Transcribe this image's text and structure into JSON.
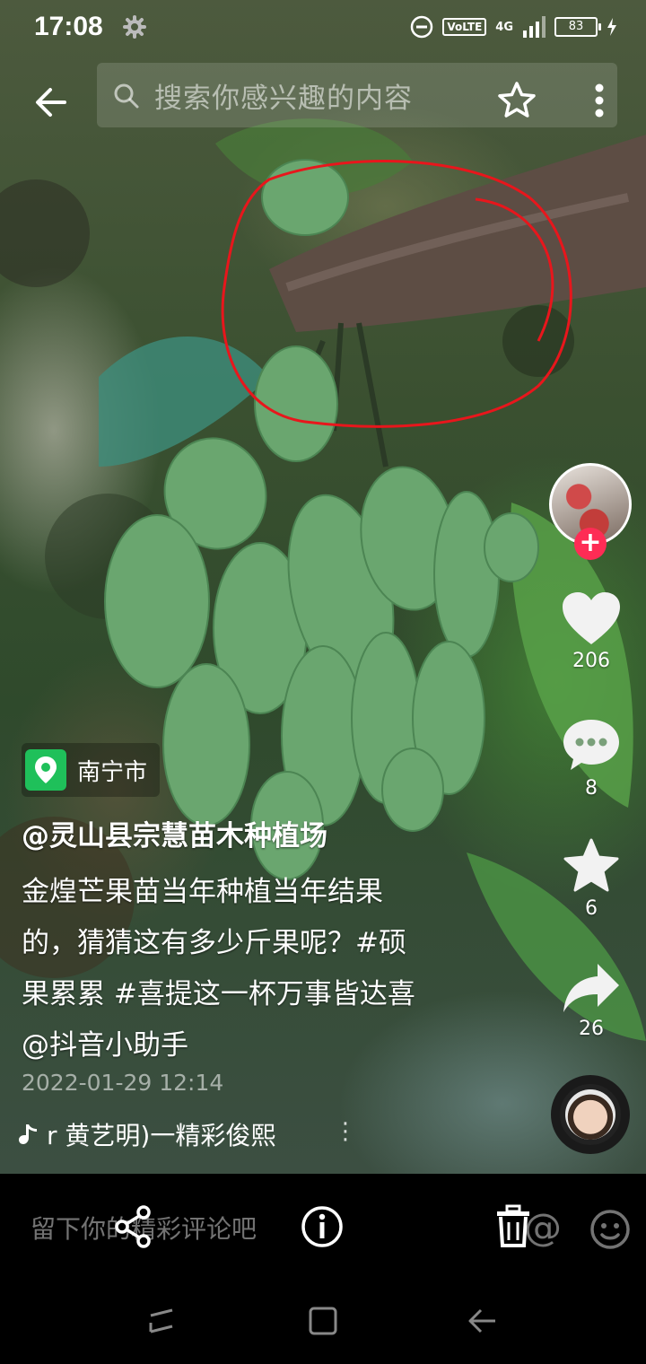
{
  "status_bar": {
    "time": "17:08",
    "network_badge": "VoLTE",
    "network_type": "4G",
    "battery": "83"
  },
  "top_bar": {
    "search_placeholder": "搜索你感兴趣的内容"
  },
  "actions": {
    "likes": "206",
    "comments": "8",
    "favorites": "6",
    "shares": "26"
  },
  "post": {
    "location": "南宁市",
    "author": "@灵山县宗慧苗木种植场",
    "caption_lines": [
      "金煌芒果苗当年种植当年结果",
      "的，猜猜这有多少斤果呢？#硕",
      "果累累 #喜提这一杯万事皆达喜",
      "@抖音小助手"
    ],
    "date": "2022-01-29 12:14",
    "music": "r 黄艺明)一精彩俊熙",
    "music_more": "⋮"
  },
  "bottom_bar": {
    "comment_placeholder": "留下你的精彩评论吧",
    "at_symbol": "@"
  },
  "colors": {
    "like_accent": "#fe2c55",
    "location_green": "#1fc05a",
    "annotation_red": "#e8161c"
  }
}
